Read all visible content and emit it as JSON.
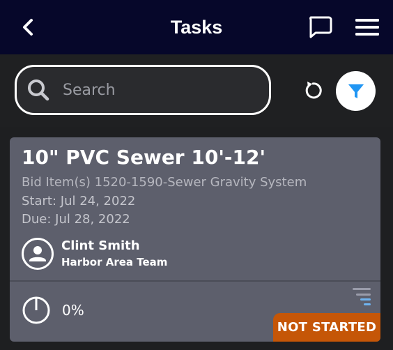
{
  "header": {
    "title": "Tasks",
    "back_icon": "chevron-left-icon",
    "chat_icon": "chat-bubble-icon",
    "menu_icon": "hamburger-menu-icon"
  },
  "search": {
    "placeholder": "Search",
    "value": "",
    "search_icon": "search-icon",
    "refresh_icon": "refresh-icon",
    "filter_icon": "filter-icon"
  },
  "colors": {
    "header_bg": "#06072a",
    "page_bg": "#1e1f21",
    "card_bg": "#5d5f6c",
    "filter_accent": "#2196f3",
    "status_not_started": "#c55607"
  },
  "tasks": [
    {
      "title": "10\" PVC Sewer 10'-12'",
      "bid_items": "Bid Item(s) 1520-1590-Sewer Gravity System",
      "start": "Start: Jul 24, 2022",
      "due": "Due: Jul 28, 2022",
      "assignee_name": "Clint Smith",
      "assignee_team": "Harbor Area Team",
      "avatar_icon": "person-icon",
      "progress": "0%",
      "progress_icon": "progress-circle-icon",
      "priority_icon": "priority-icon",
      "status": "NOT STARTED"
    }
  ]
}
